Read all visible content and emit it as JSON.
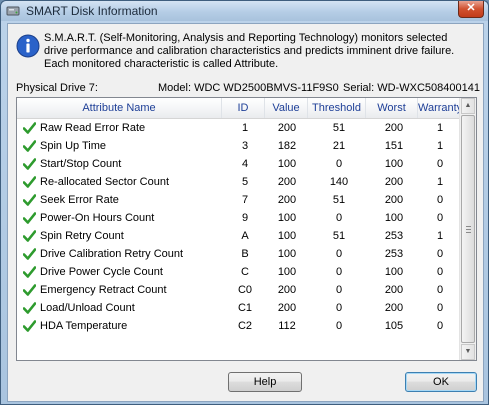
{
  "window": {
    "title": "SMART Disk Information",
    "close_glyph": "✕"
  },
  "description": "S.M.A.R.T. (Self-Monitoring, Analysis and Reporting Technology) monitors selected drive performance and calibration characteristics and predicts imminent drive failure. Each monitored characteristic is called Attribute.",
  "drive": {
    "label": "Physical Drive 7:",
    "model": "Model: WDC WD2500BMVS-11F9S0",
    "serial": "Serial: WD-WXC508400141"
  },
  "columns": [
    "Attribute Name",
    "ID",
    "Value",
    "Threshold",
    "Worst",
    "Warranty"
  ],
  "rows": [
    {
      "name": "Raw Read Error Rate",
      "id": "1",
      "value": "200",
      "threshold": "51",
      "worst": "200",
      "warranty": "1"
    },
    {
      "name": "Spin Up Time",
      "id": "3",
      "value": "182",
      "threshold": "21",
      "worst": "151",
      "warranty": "1"
    },
    {
      "name": "Start/Stop Count",
      "id": "4",
      "value": "100",
      "threshold": "0",
      "worst": "100",
      "warranty": "0"
    },
    {
      "name": "Re-allocated Sector Count",
      "id": "5",
      "value": "200",
      "threshold": "140",
      "worst": "200",
      "warranty": "1"
    },
    {
      "name": "Seek Error Rate",
      "id": "7",
      "value": "200",
      "threshold": "51",
      "worst": "200",
      "warranty": "0"
    },
    {
      "name": "Power-On Hours Count",
      "id": "9",
      "value": "100",
      "threshold": "0",
      "worst": "100",
      "warranty": "0"
    },
    {
      "name": "Spin Retry Count",
      "id": "A",
      "value": "100",
      "threshold": "51",
      "worst": "253",
      "warranty": "1"
    },
    {
      "name": "Drive Calibration Retry Count",
      "id": "B",
      "value": "100",
      "threshold": "0",
      "worst": "253",
      "warranty": "0"
    },
    {
      "name": "Drive Power Cycle Count",
      "id": "C",
      "value": "100",
      "threshold": "0",
      "worst": "100",
      "warranty": "0"
    },
    {
      "name": "Emergency Retract Count",
      "id": "C0",
      "value": "200",
      "threshold": "0",
      "worst": "200",
      "warranty": "0"
    },
    {
      "name": "Load/Unload Count",
      "id": "C1",
      "value": "200",
      "threshold": "0",
      "worst": "200",
      "warranty": "0"
    },
    {
      "name": "HDA Temperature",
      "id": "C2",
      "value": "112",
      "threshold": "0",
      "worst": "105",
      "warranty": "0"
    }
  ],
  "buttons": {
    "help": "Help",
    "ok": "OK"
  },
  "icons": {
    "title": "disk-icon",
    "info": "info-icon",
    "row_status": "check-icon"
  },
  "colors": {
    "header_text": "#1e3f97",
    "check": "#2e9b2e",
    "info": "#2a62c9"
  }
}
